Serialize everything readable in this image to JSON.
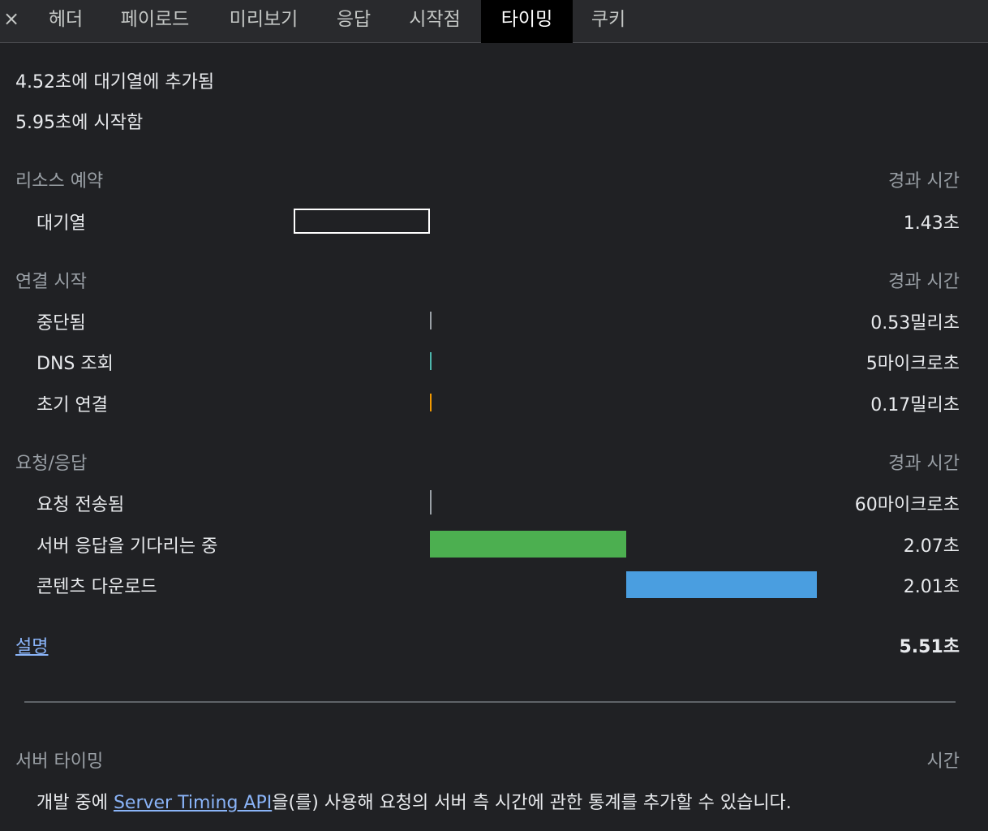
{
  "tabs": {
    "close": "×",
    "items": [
      "헤더",
      "페이로드",
      "미리보기",
      "응답",
      "시작점",
      "타이밍",
      "쿠키"
    ],
    "active": "타이밍"
  },
  "summary": {
    "queued": "4.52초에 대기열에 추가됨",
    "started": "5.95초에 시작함"
  },
  "sections": {
    "resource": {
      "title": "리소스 예약",
      "duration_header": "경과 시간",
      "rows": [
        {
          "label": "대기열",
          "value": "1.43초"
        }
      ]
    },
    "connection": {
      "title": "연결 시작",
      "duration_header": "경과 시간",
      "rows": [
        {
          "label": "중단됨",
          "value": "0.53밀리초"
        },
        {
          "label": "DNS 조회",
          "value": "5마이크로초"
        },
        {
          "label": "초기 연결",
          "value": "0.17밀리초"
        }
      ]
    },
    "request": {
      "title": "요청/응답",
      "duration_header": "경과 시간",
      "rows": [
        {
          "label": "요청 전송됨",
          "value": "60마이크로초"
        },
        {
          "label": "서버 응답을 기다리는 중",
          "value": "2.07초"
        },
        {
          "label": "콘텐츠 다운로드",
          "value": "2.01초"
        }
      ]
    }
  },
  "footer": {
    "explain_link": "설명",
    "total": "5.51초"
  },
  "server_timing": {
    "title": "서버 타이밍",
    "time_header": "시간",
    "text_before": "개발 중에 ",
    "link": "Server Timing API",
    "text_after": "을(를) 사용해 요청의 서버 측 시간에 관한 통계를 추가할 수 있습니다."
  },
  "colors": {
    "queueing_bar": "#ffffff",
    "stalled": "#9aa0a6",
    "dns": "#4db6ac",
    "initial_connection": "#f29900",
    "request_sent": "#9aa0a6",
    "waiting": "#4caf50",
    "download": "#4a9ee0",
    "link": "#8ab4f8"
  }
}
